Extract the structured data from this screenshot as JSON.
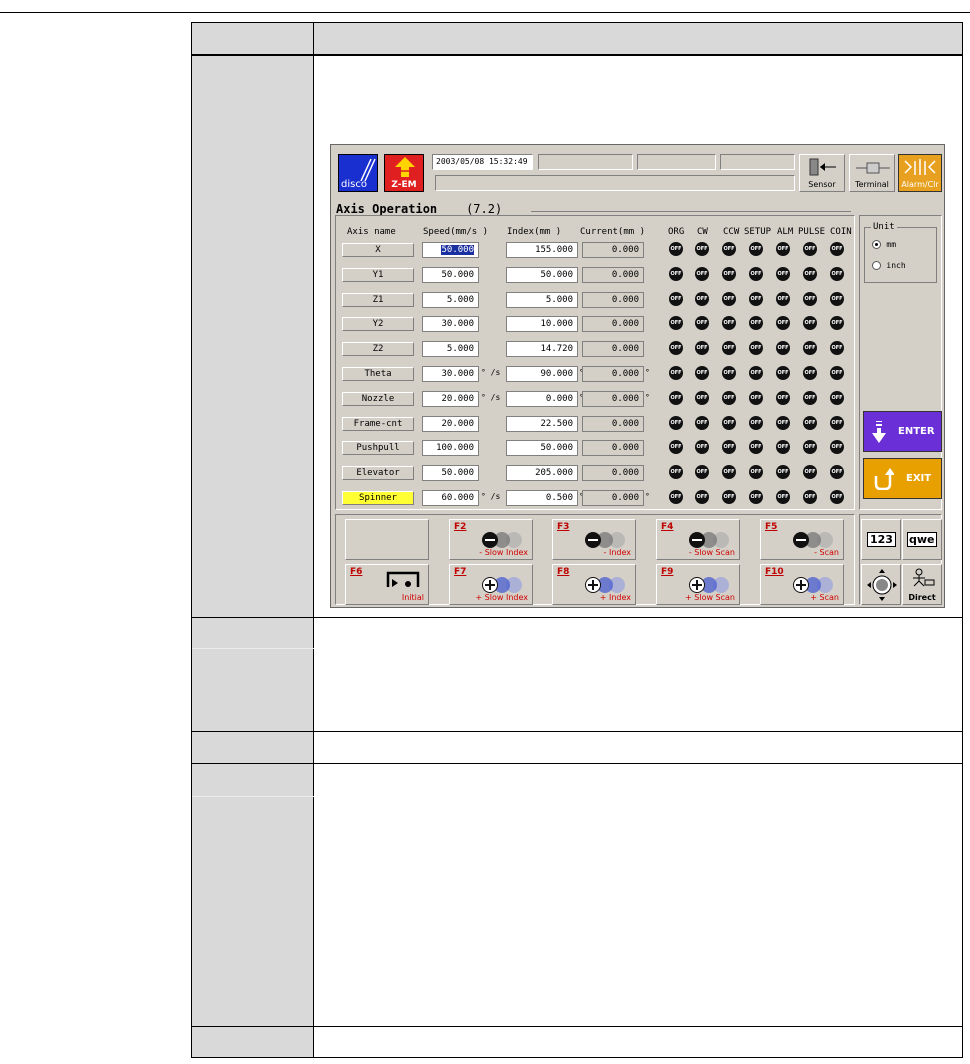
{
  "screen": {
    "datetime": "2003/05/08 15:32:49",
    "logo_text": "disco",
    "zem_label": "Z-EM",
    "sensor_label": "Sensor",
    "terminal_label": "Terminal",
    "alarm_label": "Alarm/Clr",
    "title": "Axis Operation",
    "section": "(7.2)",
    "headers": {
      "axis": "Axis name",
      "speed": "Speed(mm/s  )",
      "index": "Index(mm  )",
      "current": "Current(mm  )",
      "org": "ORG",
      "cw": "CW",
      "ccw": "CCW",
      "setup": "SETUP",
      "alm": "ALM",
      "pulse": "PULSE",
      "coin": "COIN"
    },
    "led_text": "OFF",
    "axes": [
      {
        "name": "X",
        "speed": "50.000",
        "index": "155.000",
        "current": "0.000",
        "speed_unit": "",
        "index_unit": "",
        "current_unit": ""
      },
      {
        "name": "Y1",
        "speed": "50.000",
        "index": "50.000",
        "current": "0.000",
        "speed_unit": "",
        "index_unit": "",
        "current_unit": ""
      },
      {
        "name": "Z1",
        "speed": "5.000",
        "index": "5.000",
        "current": "0.000",
        "speed_unit": "",
        "index_unit": "",
        "current_unit": ""
      },
      {
        "name": "Y2",
        "speed": "30.000",
        "index": "10.000",
        "current": "0.000",
        "speed_unit": "",
        "index_unit": "",
        "current_unit": ""
      },
      {
        "name": "Z2",
        "speed": "5.000",
        "index": "14.720",
        "current": "0.000",
        "speed_unit": "",
        "index_unit": "",
        "current_unit": ""
      },
      {
        "name": "Theta",
        "speed": "30.000",
        "index": "90.000",
        "current": "0.000",
        "speed_unit": "° /s",
        "index_unit": "°",
        "current_unit": "°"
      },
      {
        "name": "Nozzle",
        "speed": "20.000",
        "index": "0.000",
        "current": "0.000",
        "speed_unit": "° /s",
        "index_unit": "°",
        "current_unit": "°"
      },
      {
        "name": "Frame-cnt",
        "speed": "20.000",
        "index": "22.500",
        "current": "0.000",
        "speed_unit": "",
        "index_unit": "",
        "current_unit": ""
      },
      {
        "name": "Pushpull",
        "speed": "100.000",
        "index": "50.000",
        "current": "0.000",
        "speed_unit": "",
        "index_unit": "",
        "current_unit": ""
      },
      {
        "name": "Elevator",
        "speed": "50.000",
        "index": "205.000",
        "current": "0.000",
        "speed_unit": "",
        "index_unit": "",
        "current_unit": ""
      },
      {
        "name": "Spinner",
        "speed": "60.000",
        "index": "0.500",
        "current": "0.000",
        "speed_unit": "° /s",
        "index_unit": "°",
        "current_unit": "°"
      }
    ],
    "unit": {
      "label": "Unit",
      "mm": "mm",
      "inch": "inch",
      "selected": "mm"
    },
    "enter_label": "ENTER",
    "exit_label": "EXIT",
    "fkeys": {
      "f2": {
        "key": "F2",
        "label": "- Slow Index"
      },
      "f3": {
        "key": "F3",
        "label": "- Index"
      },
      "f4": {
        "key": "F4",
        "label": "- Slow Scan"
      },
      "f5": {
        "key": "F5",
        "label": "- Scan"
      },
      "f6": {
        "key": "F6",
        "label": "Initial"
      },
      "f7": {
        "key": "F7",
        "label": "+ Slow Index"
      },
      "f8": {
        "key": "F8",
        "label": "+ Index"
      },
      "f9": {
        "key": "F9",
        "label": "+ Slow Scan"
      },
      "f10": {
        "key": "F10",
        "label": "+ Scan"
      }
    },
    "num_label": "123",
    "kbd_label": "qwe",
    "direct_label": "Direct"
  },
  "colors": {
    "zem_red": "#e02020",
    "disco_blue": "#1a2fd0",
    "alarm_orange": "#e8a020",
    "enter_purple": "#6a2fd6",
    "exit_orange": "#e8a000",
    "spinner_yellow": "#ffff33",
    "fkey_red": "#d00000"
  }
}
